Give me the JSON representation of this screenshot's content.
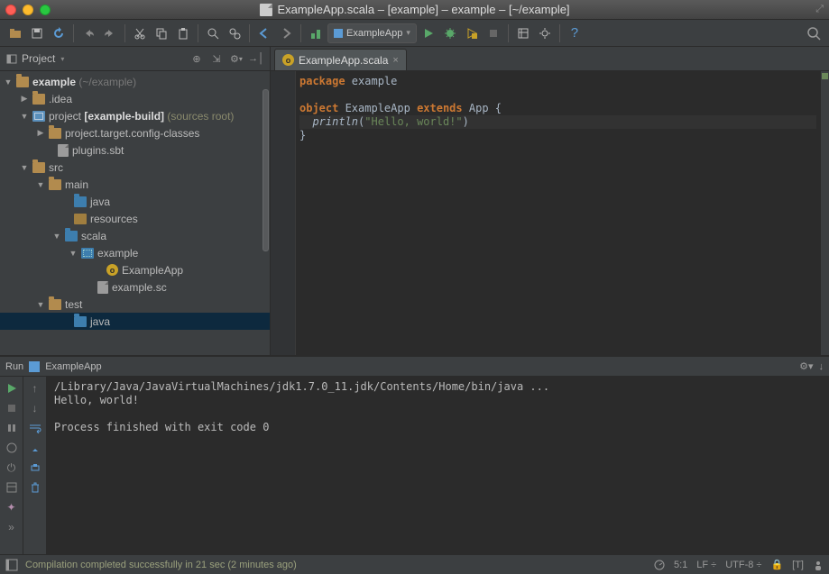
{
  "title": "ExampleApp.scala – [example] – example – [~/example]",
  "toolbar": {
    "run_config": "ExampleApp"
  },
  "project_panel": {
    "title": "Project",
    "tree": {
      "root": {
        "name": "example",
        "hint": "(~/example)"
      },
      "idea": ".idea",
      "project": {
        "name": "project",
        "build": "[example-build]",
        "role": "(sources root)"
      },
      "project_target": "project.target.config-classes",
      "plugins": "plugins.sbt",
      "src": "src",
      "main": "main",
      "java": "java",
      "resources": "resources",
      "scala": "scala",
      "examplepkg": "example",
      "exampleapp": "ExampleApp",
      "examplesc": "example.sc",
      "test": "test",
      "test_java": "java"
    }
  },
  "editor": {
    "tab": "ExampleApp.scala",
    "code": {
      "l1_kw": "package",
      "l1_rest": " example",
      "l3_kw1": "object",
      "l3_name": " ExampleApp ",
      "l3_kw2": "extends",
      "l3_rest": " App {",
      "l4_indent": "  ",
      "l4_fn": "println",
      "l4_lp": "(",
      "l4_str": "\"Hello, world!\"",
      "l4_rp": ")",
      "l5": "}"
    }
  },
  "run": {
    "header_label": "Run",
    "header_config": "ExampleApp",
    "console_l1": "/Library/Java/JavaVirtualMachines/jdk1.7.0_11.jdk/Contents/Home/bin/java ...",
    "console_l2": "Hello, world!",
    "console_l3": "",
    "console_l4": "Process finished with exit code 0"
  },
  "status": {
    "message": "Compilation completed successfully in 21 sec (2 minutes ago)",
    "pos": "5:1",
    "lf": "LF",
    "enc": "UTF-8",
    "ins": "[T]"
  }
}
